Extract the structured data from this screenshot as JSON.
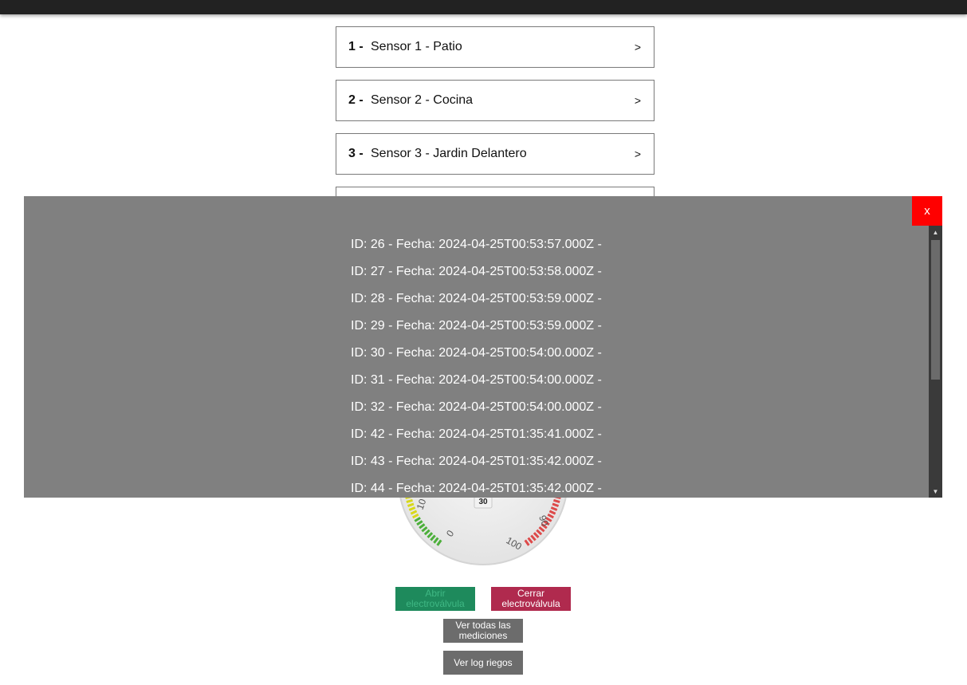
{
  "sensors": [
    {
      "num": "1 -",
      "name": "Sensor 1 -  Patio",
      "chevron": ">"
    },
    {
      "num": "2 -",
      "name": "Sensor 2 -  Cocina",
      "chevron": ">"
    },
    {
      "num": "3 -",
      "name": "Sensor 3 -  Jardin Delantero",
      "chevron": ">"
    }
  ],
  "gauge": {
    "labels": [
      "0",
      "10",
      "90",
      "100"
    ],
    "value_label": "30",
    "colors": {
      "green": "#4caf3a",
      "yellow": "#d8d81a",
      "red": "#dd4a4a"
    }
  },
  "buttons": {
    "open_valve": "Abrir electroválvula",
    "close_valve": "Cerrar electroválvula",
    "view_all": "Ver todas las mediciones",
    "view_log": "Ver log riegos"
  },
  "modal": {
    "close_label": "x",
    "rows": [
      "ID: 26 - Fecha: 2024-04-25T00:53:57.000Z -",
      "ID: 27 - Fecha: 2024-04-25T00:53:58.000Z -",
      "ID: 28 - Fecha: 2024-04-25T00:53:59.000Z -",
      "ID: 29 - Fecha: 2024-04-25T00:53:59.000Z -",
      "ID: 30 - Fecha: 2024-04-25T00:54:00.000Z -",
      "ID: 31 - Fecha: 2024-04-25T00:54:00.000Z -",
      "ID: 32 - Fecha: 2024-04-25T00:54:00.000Z -",
      "ID: 42 - Fecha: 2024-04-25T01:35:41.000Z -",
      "ID: 43 - Fecha: 2024-04-25T01:35:42.000Z -",
      "ID: 44 - Fecha: 2024-04-25T01:35:42.000Z -"
    ]
  },
  "colors": {
    "overlay": "#808080",
    "close": "#ff0000",
    "open_button": "#1e8a5c",
    "close_button": "#b02a4e",
    "neutral_button": "#6c6c6c"
  }
}
